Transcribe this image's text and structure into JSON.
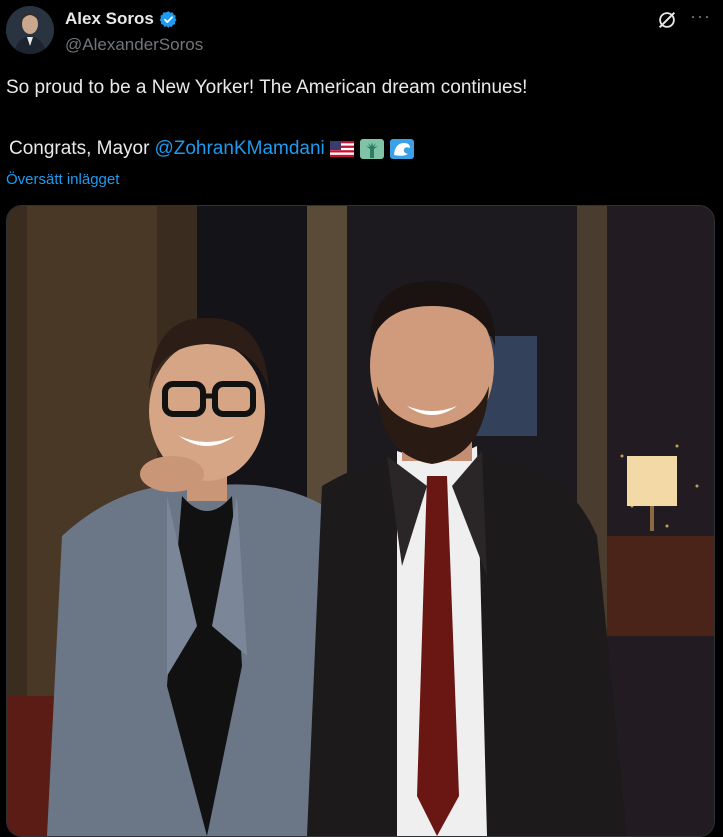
{
  "author": {
    "display_name": "Alex Soros",
    "handle": "@AlexanderSoros",
    "verified": true
  },
  "tweet": {
    "line1": "So proud to be a New Yorker! The American dream continues!",
    "line2_prefix": "Congrats, Mayor",
    "mention": "@ZohranKMamdani",
    "emojis": [
      "us-flag-emoji",
      "statue-of-liberty-emoji",
      "wave-emoji"
    ],
    "translate_link": "Översätt inlägget"
  },
  "icons": {
    "grok": "grok-icon",
    "more": "more-options-icon"
  },
  "colors": {
    "accent": "#1d9bf0",
    "background": "#000000",
    "secondary_text": "#71767b"
  }
}
